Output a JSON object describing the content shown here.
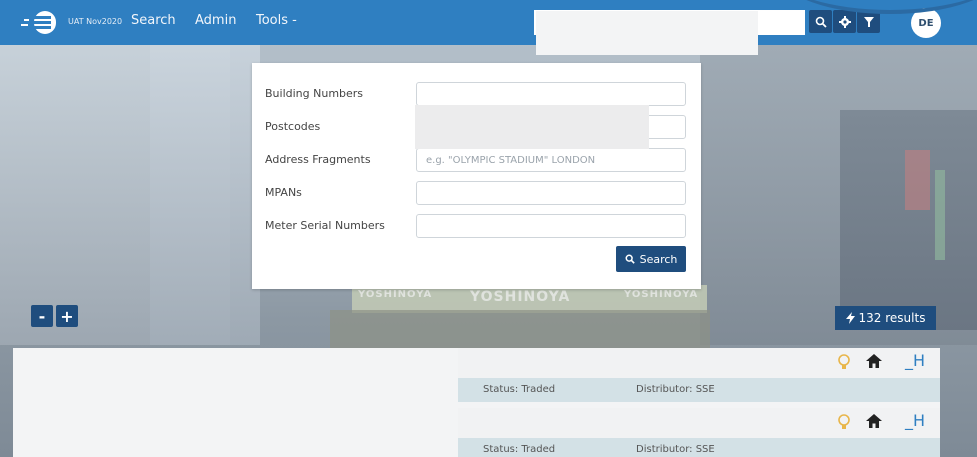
{
  "nav": {
    "env": "UAT Nov2020",
    "search": "Search",
    "admin": "Admin",
    "tools": "Tools -",
    "avatar": "DE"
  },
  "form": {
    "fields": [
      {
        "label": "Building Numbers",
        "placeholder": ""
      },
      {
        "label": "Postcodes",
        "placeholder": ""
      },
      {
        "label": "Address Fragments",
        "placeholder": "e.g. \"OLYMPIC STADIUM\" LONDON"
      },
      {
        "label": "MPANs",
        "placeholder": ""
      },
      {
        "label": "Meter Serial Numbers",
        "placeholder": ""
      }
    ],
    "search_button": "Search"
  },
  "background": {
    "sign_text_1": "YOSHINOYA",
    "sign_text_2": "YOSHINOYA",
    "sign_text_3": "YOSHINOYA"
  },
  "zoom": {
    "minus": "-",
    "plus": "+"
  },
  "results": {
    "count_label": "132 results",
    "items": [
      {
        "status": "Status: Traded",
        "distributor": "Distributor: SSE",
        "tag": "_H"
      },
      {
        "status": "Status: Traded",
        "distributor": "Distributor: SSE",
        "tag": "_H"
      }
    ]
  },
  "colors": {
    "navbar": "#2f7fc1",
    "dark_button": "#1f4d7e",
    "status_bar": "#d3e1e6",
    "bulb": "#e8b64a"
  }
}
